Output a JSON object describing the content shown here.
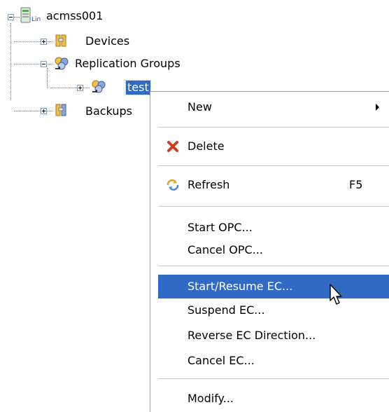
{
  "tree": {
    "root": {
      "label": "acmss001",
      "badge": "Lin"
    },
    "devices": {
      "label": "Devices"
    },
    "replication_groups": {
      "label": "Replication Groups"
    },
    "test": {
      "label": "test"
    },
    "backups": {
      "label": "Backups"
    }
  },
  "menu": {
    "items": [
      {
        "label": "New",
        "submenu": true
      },
      {
        "label": "Delete",
        "icon": "delete-x-icon"
      },
      {
        "label": "Refresh",
        "icon": "refresh-icon",
        "shortcut": "F5"
      },
      {
        "label": "Start OPC..."
      },
      {
        "label": "Cancel OPC..."
      },
      {
        "label": "Start/Resume EC...",
        "highlighted": true
      },
      {
        "label": "Suspend EC..."
      },
      {
        "label": "Reverse EC Direction..."
      },
      {
        "label": "Cancel EC..."
      },
      {
        "label": "Modify..."
      }
    ]
  },
  "colors": {
    "highlight": "#316ac5",
    "delete_icon": "#d23b1f",
    "folder": "#f2c04a"
  }
}
